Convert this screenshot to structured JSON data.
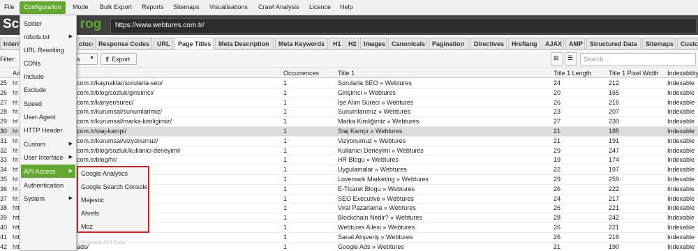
{
  "menubar": {
    "items": [
      "File",
      "Configuration",
      "Mode",
      "Bulk Export",
      "Reports",
      "Sitemaps",
      "Visualisations",
      "Crawl Analysis",
      "Licence",
      "Help"
    ]
  },
  "brand": {
    "logo_prefix": "Scr",
    "logo_suffix": "rog"
  },
  "url_bar": {
    "value": "https://www.webtures.com.tr/"
  },
  "tabs": [
    "Intern",
    "otocol",
    "Response Codes",
    "URL",
    "Page Titles",
    "Meta Description",
    "Meta Keywords",
    "H1",
    "H2",
    "Images",
    "Canonicals",
    "Pagination",
    "Directives",
    "Hreflang",
    "AJAX",
    "AMP",
    "Structured Data",
    "Sitemaps",
    "Custo"
  ],
  "filter": {
    "label": "Filter:",
    "select_fragment": "s",
    "export_label": "Export",
    "search_placeholder": "Search..."
  },
  "columns": {
    "address": "Ad",
    "occurrences": "Occurrences",
    "title1": "Title 1",
    "title1_length": "Title 1 Length",
    "title1_pixel": "Title 1 Pixel Width",
    "indexability": "Indexability"
  },
  "rows": [
    {
      "n": "25",
      "a": "ht",
      "p": "com.tr/kaynaklar/sorularla-seo/",
      "o": "1",
      "t": "Sorularla SEO » Webtures",
      "l": "24",
      "w": "212",
      "i": "Indexable"
    },
    {
      "n": "26",
      "a": "ht",
      "p": "com.tr/blog/sozluk/girisimci/",
      "o": "1",
      "t": "Girişimci » Webtures",
      "l": "20",
      "w": "165",
      "i": "Indexable"
    },
    {
      "n": "27",
      "a": "ht",
      "p": "com.tr/kariyer/surec/",
      "o": "1",
      "t": "İşe Alım Süreci » Webtures",
      "l": "26",
      "w": "216",
      "i": "Indexable"
    },
    {
      "n": "28",
      "a": "ht",
      "p": "com.tr/kurumsal/sunumlarimiz/",
      "o": "1",
      "t": "Sunumlarımız » Webtures",
      "l": "23",
      "w": "207",
      "i": "Indexable"
    },
    {
      "n": "29",
      "a": "ht",
      "p": "com.tr/kurumsal/marka-kimligimiz/",
      "o": "1",
      "t": "Marka Kimliğimiz » Webtures",
      "l": "27",
      "w": "230",
      "i": "Indexable"
    },
    {
      "n": "30",
      "a": "ht",
      "p": "com.tr/staj-kampi/",
      "o": "1",
      "t": "Staj Kampı » Webtures",
      "l": "21",
      "w": "185",
      "i": "Indexable"
    },
    {
      "n": "31",
      "a": "ht",
      "p": "com.tr/kurumsal/vizyonumuz/",
      "o": "1",
      "t": "Vizyonumuz » Webtures",
      "l": "21",
      "w": "191",
      "i": "Indexable"
    },
    {
      "n": "32",
      "a": "ht",
      "p": "com.tr/blog/sozluk/kullanici-deneyimi/",
      "o": "1",
      "t": "Kullanıcı Deneyimi » Webtures",
      "l": "29",
      "w": "247",
      "i": "Indexable"
    },
    {
      "n": "33",
      "a": "ht",
      "p": "com.tr/blog/hr/",
      "o": "1",
      "t": "HR Blogu » Webtures",
      "l": "19",
      "w": "174",
      "i": "Indexable"
    },
    {
      "n": "34",
      "a": "ht",
      "p": "alar/",
      "o": "1",
      "t": "Uygulamalar » Webtures",
      "l": "22",
      "w": "197",
      "i": "Indexable"
    },
    {
      "n": "35",
      "a": "ht",
      "p": "",
      "o": "1",
      "t": "Lovemark Marketing » Webtures",
      "l": "29",
      "w": "259",
      "i": "Indexable"
    },
    {
      "n": "36",
      "a": "ht",
      "p": "",
      "o": "1",
      "t": "E-Ticaret Blogu » Webtures",
      "l": "26",
      "w": "222",
      "i": "Indexable"
    },
    {
      "n": "37",
      "a": "ht",
      "p": "",
      "o": "1",
      "t": "SEO Executive » Webtures",
      "l": "24",
      "w": "217",
      "i": "Indexable"
    },
    {
      "n": "38",
      "a": "https://www.webtures",
      "p": "zarlama/",
      "o": "1",
      "t": "Viral Pazarlama » Webtures",
      "l": "26",
      "w": "221",
      "i": "Indexable"
    },
    {
      "n": "39",
      "a": "https://www.webtures",
      "p": "ain-nedir/",
      "o": "1",
      "t": "Blockchain Nedir? » Webtures",
      "l": "28",
      "w": "242",
      "i": "Indexable"
    },
    {
      "n": "40",
      "a": "https://www.webtures",
      "p": "i/",
      "o": "1",
      "t": "Webtures Ailesi » Webtures",
      "l": "26",
      "w": "221",
      "i": "Indexable"
    },
    {
      "n": "41",
      "a": "https://www.webtures",
      "p": "",
      "o": "1",
      "t": "Sanal Alışveriş » Webtures",
      "l": "26",
      "w": "216",
      "i": "Indexable"
    },
    {
      "n": "42",
      "a": "https://www.webtures",
      "p": "ads/",
      "o": "1",
      "t": "Google Ads » Webtures",
      "l": "21",
      "w": "190",
      "i": "Indexable"
    }
  ],
  "config_menu": [
    {
      "label": "Spider"
    },
    {
      "label": "robots.txt"
    },
    {
      "label": "URL Rewriting"
    },
    {
      "label": "CDNs"
    },
    {
      "label": "Include"
    },
    {
      "label": "Exclude"
    },
    {
      "label": "Speed"
    },
    {
      "label": "User-Agent"
    },
    {
      "label": "HTTP Header"
    },
    {
      "label": "Custom"
    },
    {
      "label": "User Interface"
    },
    {
      "label": "API Access"
    },
    {
      "label": "Authentication"
    },
    {
      "label": "System"
    }
  ],
  "api_submenu": [
    "Google Analytics",
    "Google Search Console",
    "Majestic",
    "Ahrefs",
    "Moz"
  ],
  "request_api_label": "Request API Data",
  "colors": {
    "accent": "#62a82e",
    "highlight_border": "#d32020",
    "brand_bg": "#404040"
  }
}
